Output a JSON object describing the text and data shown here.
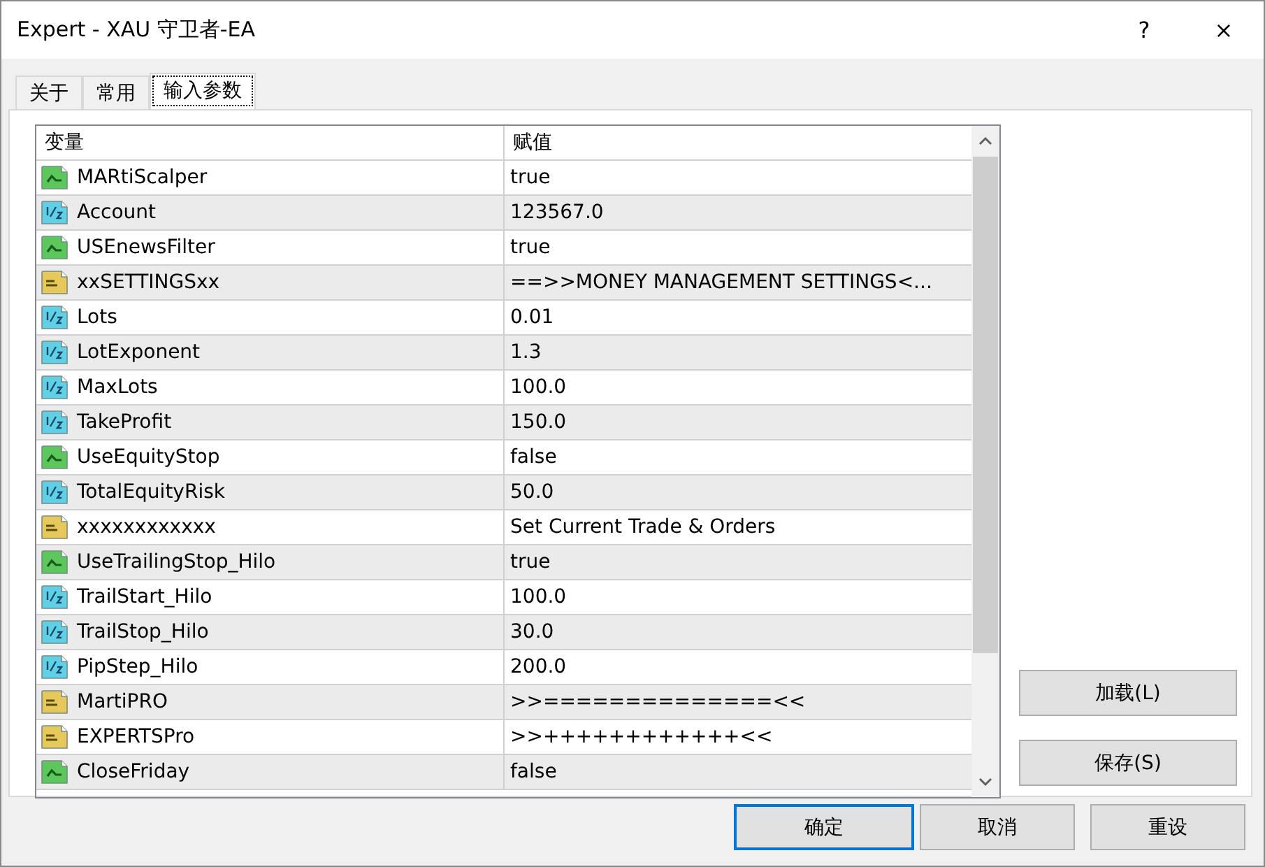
{
  "window": {
    "title": "Expert - XAU 守卫者-EA",
    "help": "?",
    "close": "×"
  },
  "tabs": [
    {
      "label": "关于",
      "selected": false
    },
    {
      "label": "常用",
      "selected": false
    },
    {
      "label": "输入参数",
      "selected": true
    }
  ],
  "table": {
    "columns": [
      "变量",
      "赋值"
    ],
    "rows": [
      {
        "kind": "bool",
        "name": "MARtiScalper",
        "value": "true"
      },
      {
        "kind": "number",
        "name": "Account",
        "value": "123567.0"
      },
      {
        "kind": "bool",
        "name": "USEnewsFilter",
        "value": "true"
      },
      {
        "kind": "string",
        "name": "xxSETTINGSxx",
        "value": "==>>MONEY MANAGEMENT SETTINGS<..."
      },
      {
        "kind": "number",
        "name": "Lots",
        "value": "0.01"
      },
      {
        "kind": "number",
        "name": "LotExponent",
        "value": "1.3"
      },
      {
        "kind": "number",
        "name": "MaxLots",
        "value": "100.0"
      },
      {
        "kind": "number",
        "name": "TakeProfit",
        "value": "150.0"
      },
      {
        "kind": "bool",
        "name": "UseEquityStop",
        "value": "false"
      },
      {
        "kind": "number",
        "name": "TotalEquityRisk",
        "value": "50.0"
      },
      {
        "kind": "string",
        "name": "xxxxxxxxxxxx",
        "value": "Set Current Trade & Orders"
      },
      {
        "kind": "bool",
        "name": "UseTrailingStop_Hilo",
        "value": "true"
      },
      {
        "kind": "number",
        "name": "TrailStart_Hilo",
        "value": "100.0"
      },
      {
        "kind": "number",
        "name": "TrailStop_Hilo",
        "value": "30.0"
      },
      {
        "kind": "number",
        "name": "PipStep_Hilo",
        "value": "200.0"
      },
      {
        "kind": "string",
        "name": "MartiPRO",
        "value": ">>==============<<"
      },
      {
        "kind": "string",
        "name": "EXPERTSPro",
        "value": ">>++++++++++++<<"
      },
      {
        "kind": "bool",
        "name": "CloseFriday",
        "value": "false"
      }
    ]
  },
  "side_buttons": [
    "加载(L)",
    "保存(S)"
  ],
  "buttons": [
    {
      "label": "确定",
      "focused": true
    },
    {
      "label": "取消",
      "focused": false
    },
    {
      "label": "重设",
      "focused": false
    }
  ]
}
